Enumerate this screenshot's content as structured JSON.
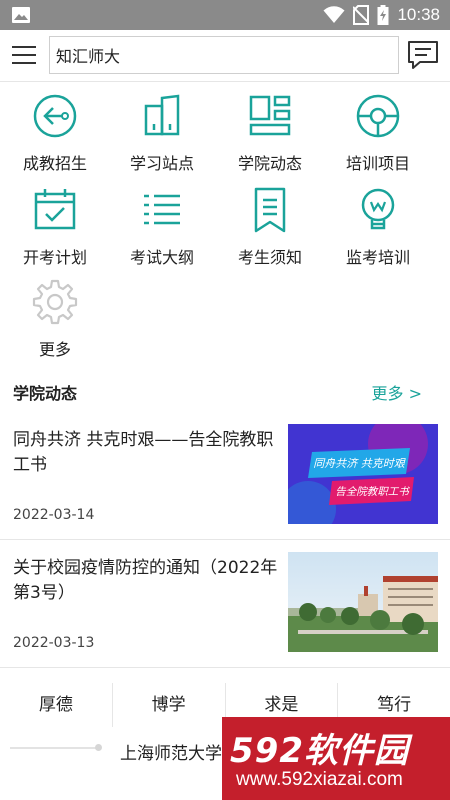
{
  "status_bar": {
    "time": "10:38",
    "icons": [
      "image-icon",
      "wifi-icon",
      "no-sim-icon",
      "battery-icon"
    ]
  },
  "header": {
    "menu_icon": "hamburger-menu-icon",
    "search_value": "知汇师大",
    "message_icon": "message-icon"
  },
  "grid": [
    {
      "label": "成教招生",
      "icon": "enroll-icon"
    },
    {
      "label": "学习站点",
      "icon": "study-site-icon"
    },
    {
      "label": "学院动态",
      "icon": "dashboard-icon"
    },
    {
      "label": "培训项目",
      "icon": "training-icon"
    },
    {
      "label": "开考计划",
      "icon": "calendar-check-icon"
    },
    {
      "label": "考试大纲",
      "icon": "list-icon"
    },
    {
      "label": "考生须知",
      "icon": "bookmark-doc-icon"
    },
    {
      "label": "监考培训",
      "icon": "lightbulb-icon"
    },
    {
      "label": "更多",
      "icon": "gear-icon"
    }
  ],
  "section": {
    "title": "学院动态",
    "more": "更多 >"
  },
  "news": [
    {
      "title": "同舟共济 共克时艰——告全院教职工书",
      "date": "2022-03-14",
      "thumb_line1": "同舟共济 共克时艰",
      "thumb_line2": "告全院教职工书"
    },
    {
      "title": "关于校园疫情防控的通知（2022年第3号）",
      "date": "2022-03-13"
    }
  ],
  "footer": {
    "mottos": [
      "厚德",
      "博学",
      "求是",
      "笃行"
    ],
    "university": "上海师范大学继续教育学院"
  },
  "watermark": {
    "line1": "592软件园",
    "line2": "www.592xiazai.com"
  },
  "colors": {
    "accent": "#1aa39a",
    "status_bar": "#8a8a8a",
    "watermark": "#c41f2c"
  }
}
